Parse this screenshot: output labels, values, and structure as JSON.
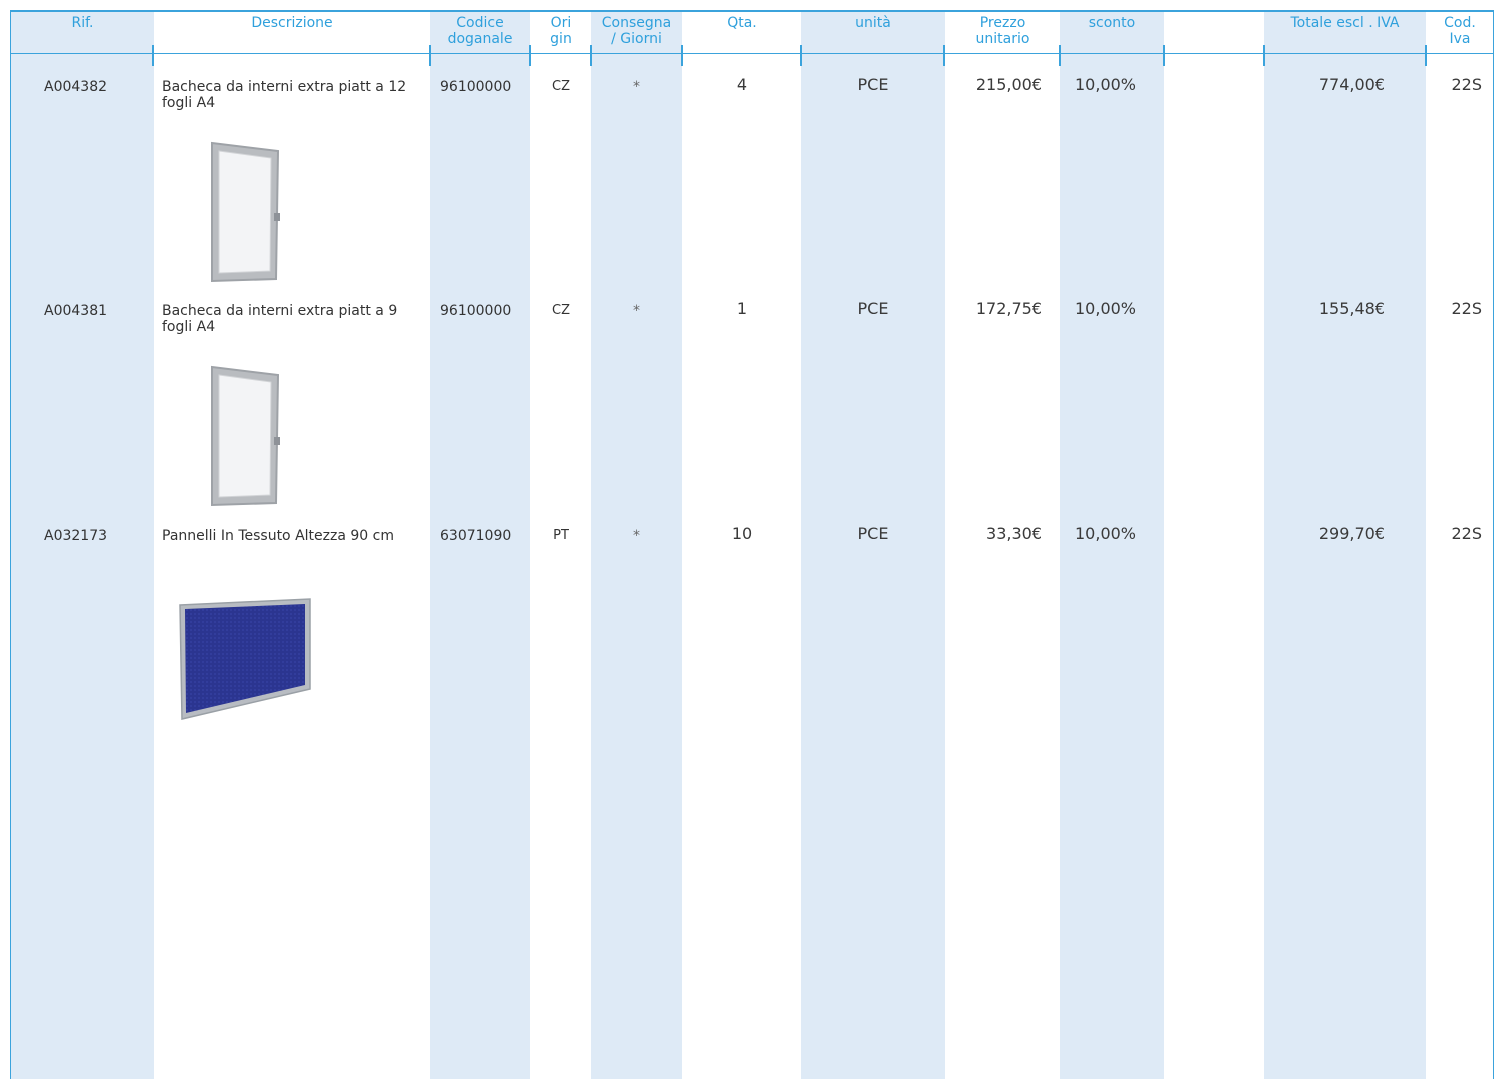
{
  "headers": {
    "rif": "Rif.",
    "descrizione": "Descrizione",
    "codice": "Codice\ndoganale",
    "origin": "Ori\ngin",
    "consegna": "Consegna\n/ Giorni",
    "qta": "Qta.",
    "unita": "unità",
    "prezzo": "Prezzo\nunitario",
    "sconto": "sconto",
    "totale": "Totale escl . IVA",
    "cod_iva": "Cod.\nIva"
  },
  "rows": [
    {
      "rif": "A004382",
      "descrizione": "Bacheca da interni extra piatt a 12 fogli A4",
      "codice": "96100000",
      "origin": "CZ",
      "consegna": "*",
      "qta": "4",
      "unita": "PCE",
      "prezzo": "215,00€",
      "sconto": "10,00%",
      "totale": "774,00€",
      "cod_iva": "22S",
      "image": "notice-board-image"
    },
    {
      "rif": "A004381",
      "descrizione": "Bacheca da interni extra piatt a 9 fogli A4",
      "codice": "96100000",
      "origin": "CZ",
      "consegna": "*",
      "qta": "1",
      "unita": "PCE",
      "prezzo": "172,75€",
      "sconto": "10,00%",
      "totale": "155,48€",
      "cod_iva": "22S",
      "image": "notice-board-image"
    },
    {
      "rif": "A032173",
      "descrizione": "Pannelli In Tessuto Altezza 90 cm",
      "codice": "63071090",
      "origin": "PT",
      "consegna": "*",
      "qta": "10",
      "unita": "PCE",
      "prezzo": "33,30€",
      "sconto": "10,00%",
      "totale": "299,70€",
      "cod_iva": "22S",
      "image": "fabric-panel-image"
    }
  ],
  "colors": {
    "accent": "#3ba3dc",
    "band": "#deeaf6",
    "text": "#333333",
    "fabric": "#2b3590"
  }
}
